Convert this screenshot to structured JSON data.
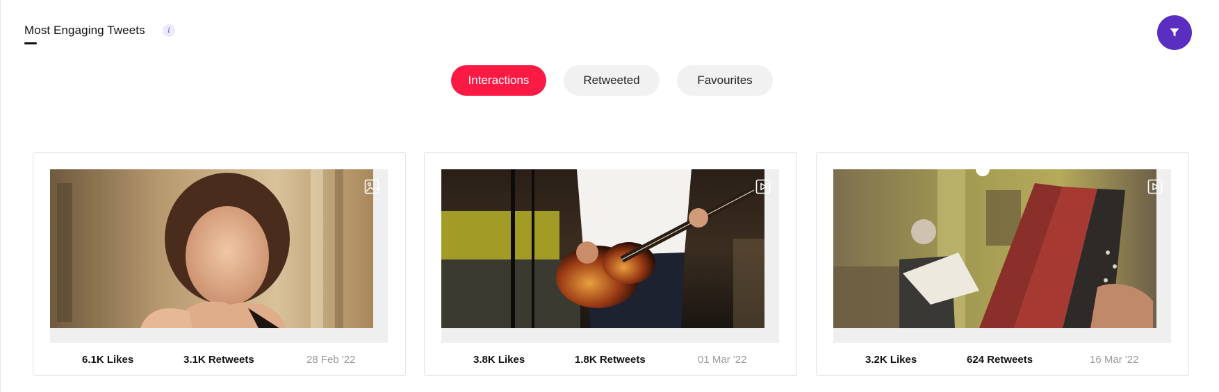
{
  "header": {
    "title": "Most Engaging Tweets",
    "info_icon": "info-icon",
    "info_glyph": "i",
    "filter_icon": "filter-icon",
    "filter_color": "#5b2ec2"
  },
  "tabs": [
    {
      "label": "Interactions",
      "active": true
    },
    {
      "label": "Retweeted",
      "active": false
    },
    {
      "label": "Favourites",
      "active": false
    }
  ],
  "colors": {
    "active_tab": "#fa1a44",
    "inactive_tab": "#f1f1f1",
    "date_text": "#9a9a9a"
  },
  "tweets": [
    {
      "media_type": "image-icon",
      "likes": "6.1K Likes",
      "retweets": "3.1K Retweets",
      "date": "28 Feb '22"
    },
    {
      "media_type": "video-icon",
      "likes": "3.8K Likes",
      "retweets": "1.8K Retweets",
      "date": "01 Mar '22"
    },
    {
      "media_type": "video-icon",
      "likes": "3.2K Likes",
      "retweets": "624 Retweets",
      "date": "16 Mar '22"
    }
  ]
}
